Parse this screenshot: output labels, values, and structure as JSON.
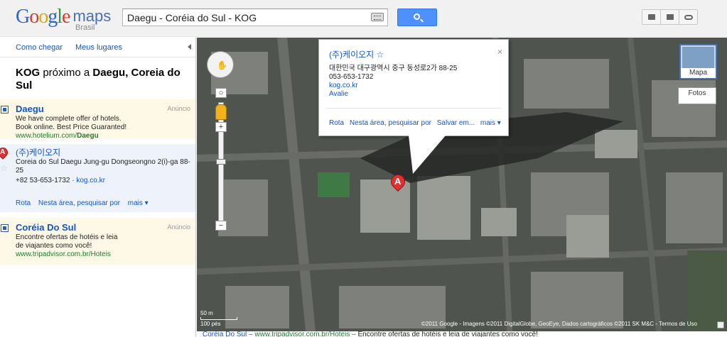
{
  "app": {
    "logo_text": "Google",
    "logo_suffix": "maps",
    "logo_country": "Brasil"
  },
  "search": {
    "value": "Daegu - Coréia do Sul - KOG"
  },
  "toolbar": {
    "icons": [
      "print-icon",
      "mail-icon",
      "link-icon"
    ]
  },
  "sidebar": {
    "nav": {
      "directions": "Como chegar",
      "my_places": "Meus lugares"
    },
    "title": {
      "query": "KOG",
      "near": "próximo a",
      "place": "Daegu, Coreia do Sul"
    },
    "ads": [
      {
        "label": "Anúncio",
        "title": "Daegu",
        "lines": [
          "We have complete offer of hotels.",
          "Book online. Best Price Guaranted!"
        ],
        "url_prefix": "www.hotelium.com/",
        "url_bold": "Daegu"
      },
      {
        "label": "Anúncio",
        "title": "Coréia Do Sul",
        "lines": [
          "Encontre ofertas de hotéis e leia",
          "de viajantes como você!"
        ],
        "url": "www.tripadvisor.com.br/Hoteis"
      }
    ],
    "listing": {
      "marker": "A",
      "name": "(주)케이오지",
      "address": "Coreia do Sul Daegu Jung-gu Dongseongno 2(i)-ga 88-25",
      "phone": "+82 53-653-1732",
      "separator": "·",
      "website": "kog.co.kr",
      "actions": {
        "route": "Rota",
        "nearby": "Nesta área, pesquisar por",
        "more": "mais ▾"
      }
    }
  },
  "infowindow": {
    "title": "(주)케이오지",
    "address": "대한민국 대구광역시 중구 동성로2가 88-25",
    "phone": "053-653-1732",
    "website": "kog.co.kr",
    "review": "Avalie",
    "close": "×",
    "actions": {
      "route": "Rota",
      "nearby": "Nesta área, pesquisar por",
      "save": "Salvar em...",
      "more": "mais ▾"
    }
  },
  "map": {
    "marker": "A",
    "type_map": "Mapa",
    "type_photos": "Fotos",
    "scale_m": "50 m",
    "scale_ft": "100 pés",
    "attribution": "©2011 Google - Imagens ©2011 DigitalGlobe, GeoEye, Dados cartográficos ©2011 SK M&C - Termos de Uso",
    "zoom_in": "+",
    "zoom_out": "−",
    "colors": {
      "marker": "#e03030",
      "link": "#1155cc",
      "ad_background": "#fef8e6",
      "selected_background": "#eef3fb"
    }
  },
  "bottom_strip": {
    "title": "Coréia Do Sul",
    "url": "www.tripadvisor.com.br/Hoteis",
    "text": "Encontre ofertas de hotéis e leia de viajantes como você!"
  }
}
